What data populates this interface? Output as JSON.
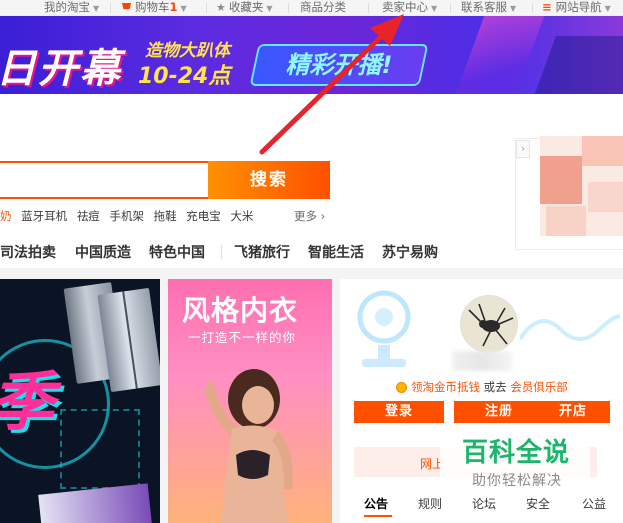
{
  "topbar": {
    "my_taobao": "我的淘宝",
    "cart": "购物车",
    "cart_count": "1",
    "favorites": "收藏夹",
    "categories": "商品分类",
    "seller_center": "卖家中心",
    "customer_service": "联系客服",
    "site_nav": "网站导航"
  },
  "banner": {
    "big_text": "日开幕",
    "line1": "造物大趴体",
    "line2": "10-24点",
    "pill": "精彩开播!"
  },
  "search": {
    "value": "",
    "button": "搜索",
    "hot_words": [
      "奶",
      "蓝牙耳机",
      "祛痘",
      "手机架",
      "拖鞋",
      "充电宝",
      "大米"
    ],
    "more": "更多"
  },
  "nav": {
    "items": [
      "司法拍卖",
      "中国质造",
      "特色中国",
      "飞猪旅行",
      "智能生活",
      "苏宁易购"
    ]
  },
  "promo": {
    "season_char": "季",
    "lingerie_title": "风格内衣",
    "lingerie_sub": "一打造不一样的你"
  },
  "user": {
    "coins_text": "领淘金币抵钱",
    "or_text": "或去",
    "club": "会员俱乐部",
    "login": "登录",
    "register": "注册",
    "open_shop": "开店",
    "notice": "网上",
    "tabs": [
      "公告",
      "规则",
      "论坛",
      "安全",
      "公益"
    ]
  },
  "watermark": {
    "title": "百科全说",
    "sub": "助你轻松解决"
  },
  "colors": {
    "accent": "#ff5000",
    "arrow": "#e8232a",
    "watermark": "#1bb56c"
  }
}
